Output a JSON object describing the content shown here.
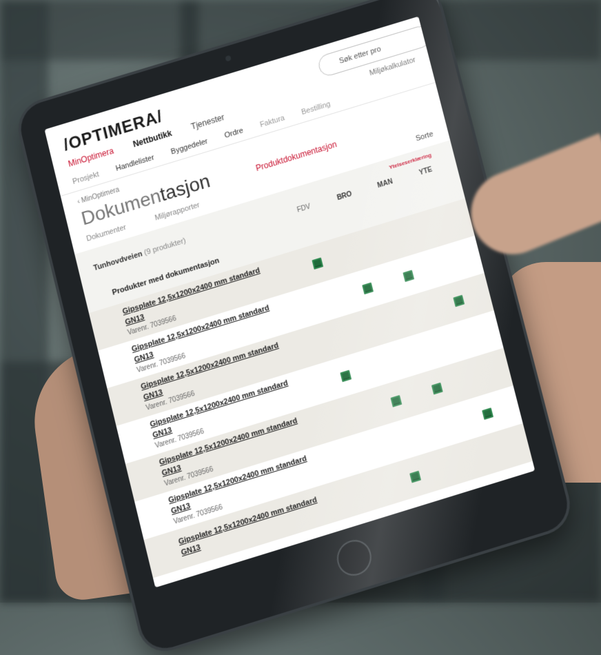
{
  "header": {
    "logo": "/OPTIMERA/",
    "search_placeholder": "Søk etter pro",
    "main_nav": [
      "MinOptimera",
      "Nettbutikk",
      "Tjenester",
      "Miljøkalkulator"
    ]
  },
  "sub_nav": [
    "Prosjekt",
    "Handlelister",
    "Byggedeler",
    "Ordre",
    "Faktura",
    "Bestilling"
  ],
  "breadcrumb": "‹ MinOptimera",
  "page_title": {
    "part1": "Dokumen",
    "part2": "tasjon"
  },
  "page_tabs": {
    "dokumenter": "Dokumenter",
    "miljorapporter": "Miljørapporter",
    "produktdokumentasjon": "Produktdokumentasjon",
    "sort": "Sorte"
  },
  "table": {
    "project_name": "Tunhovdveien",
    "project_count": "(9 produkter)",
    "products_heading": "Produkter med dokumentasjon",
    "columns": [
      "FDV",
      "BRO",
      "MAN",
      "YTE"
    ],
    "column_note": "Ytelseserklæring",
    "rows": [
      {
        "name": "Gipsplate 12,5x1200x2400 mm standard GN13",
        "varenr": "Varenr. 7039566",
        "docs": [
          true,
          false,
          false,
          false
        ]
      },
      {
        "name": "Gipsplate 12,5x1200x2400 mm standard GN13",
        "varenr": "Varenr. 7039566",
        "docs": [
          false,
          true,
          true,
          false
        ]
      },
      {
        "name": "Gipsplate 12,5x1200x2400 mm standard GN13",
        "varenr": "Varenr. 7039566",
        "docs": [
          false,
          false,
          false,
          true
        ]
      },
      {
        "name": "Gipsplate 12,5x1200x2400 mm standard GN13",
        "varenr": "Varenr. 7039566",
        "docs": [
          true,
          false,
          false,
          false
        ]
      },
      {
        "name": "Gipsplate 12,5x1200x2400 mm standard GN13",
        "varenr": "Varenr. 7039566",
        "docs": [
          false,
          true,
          true,
          false
        ]
      },
      {
        "name": "Gipsplate 12,5x1200x2400 mm standard GN13",
        "varenr": "Varenr. 7039566",
        "docs": [
          false,
          false,
          false,
          true
        ]
      },
      {
        "name": "Gipsplate 12,5x1200x2400 mm standard GN13",
        "varenr": "",
        "docs": [
          false,
          true,
          false,
          false
        ]
      }
    ]
  },
  "colors": {
    "brand_red": "#c8102e",
    "doc_icon_green": "#1f6b3a"
  },
  "icons": {
    "document": "green-document-icon",
    "search": "search-icon"
  }
}
